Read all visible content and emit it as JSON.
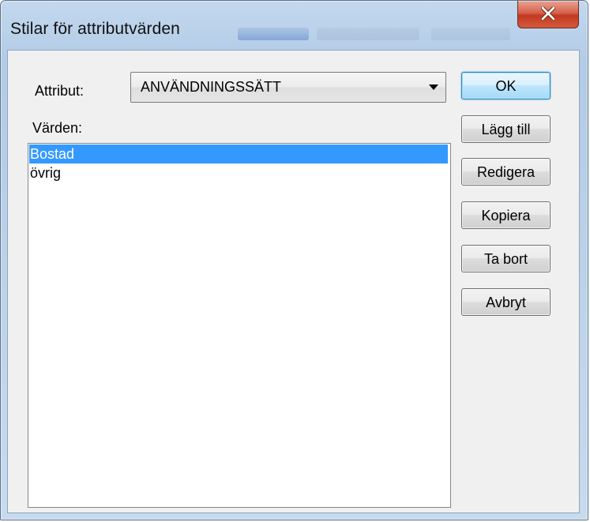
{
  "window": {
    "title": "Stilar för attributvärden"
  },
  "titlebar": {
    "close_icon": "close-x-icon"
  },
  "form": {
    "attribute_label": "Attribut:",
    "attribute_value": "ANVÄNDNINGSSÄTT",
    "dropdown_icon": "chevron-down-icon",
    "values_label": "Värden:",
    "values": [
      {
        "label": "Bostad",
        "selected": true
      },
      {
        "label": "övrig",
        "selected": false
      }
    ]
  },
  "buttons": {
    "ok": "OK",
    "add": "Lägg till",
    "edit": "Redigera",
    "copy": "Kopiera",
    "remove": "Ta bort",
    "cancel": "Avbryt"
  },
  "colors": {
    "selection": "#3399ff",
    "close_button": "#c2381f",
    "frame": "#b9d0e8"
  }
}
